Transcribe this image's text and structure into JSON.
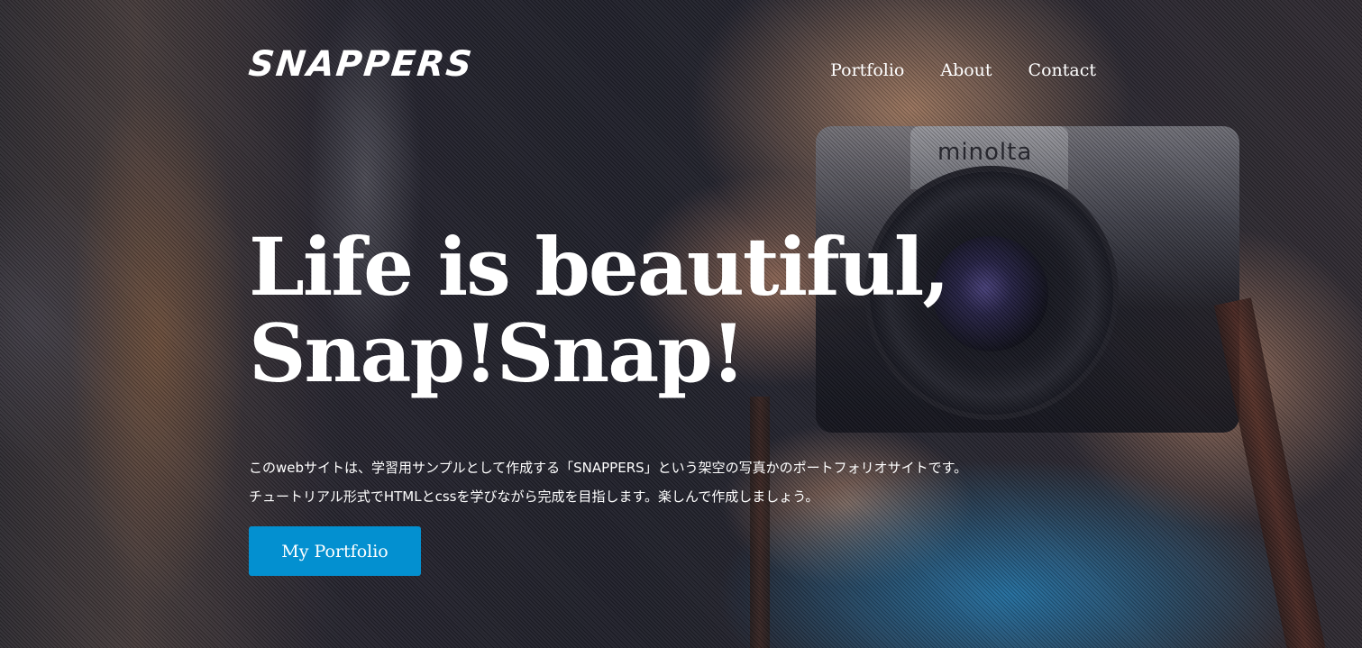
{
  "header": {
    "logo": "SNAPPERS",
    "nav": [
      {
        "label": "Portfolio"
      },
      {
        "label": "About"
      },
      {
        "label": "Contact"
      }
    ]
  },
  "hero": {
    "headline_line1": "Life is beautiful,",
    "headline_line2": "Snap!Snap!",
    "description_line1": "このwebサイトは、学習用サンプルとして作成する「SNAPPERS」という架空の写真かのポートフォリオサイトです。",
    "description_line2": "チュートリアル形式でHTMLとcssを学びながら完成を目指します。楽しんで作成しましょう。",
    "cta_label": "My Portfolio"
  },
  "background": {
    "camera_brand": "minolta"
  },
  "colors": {
    "accent": "#0390d0",
    "text": "#ffffff"
  }
}
